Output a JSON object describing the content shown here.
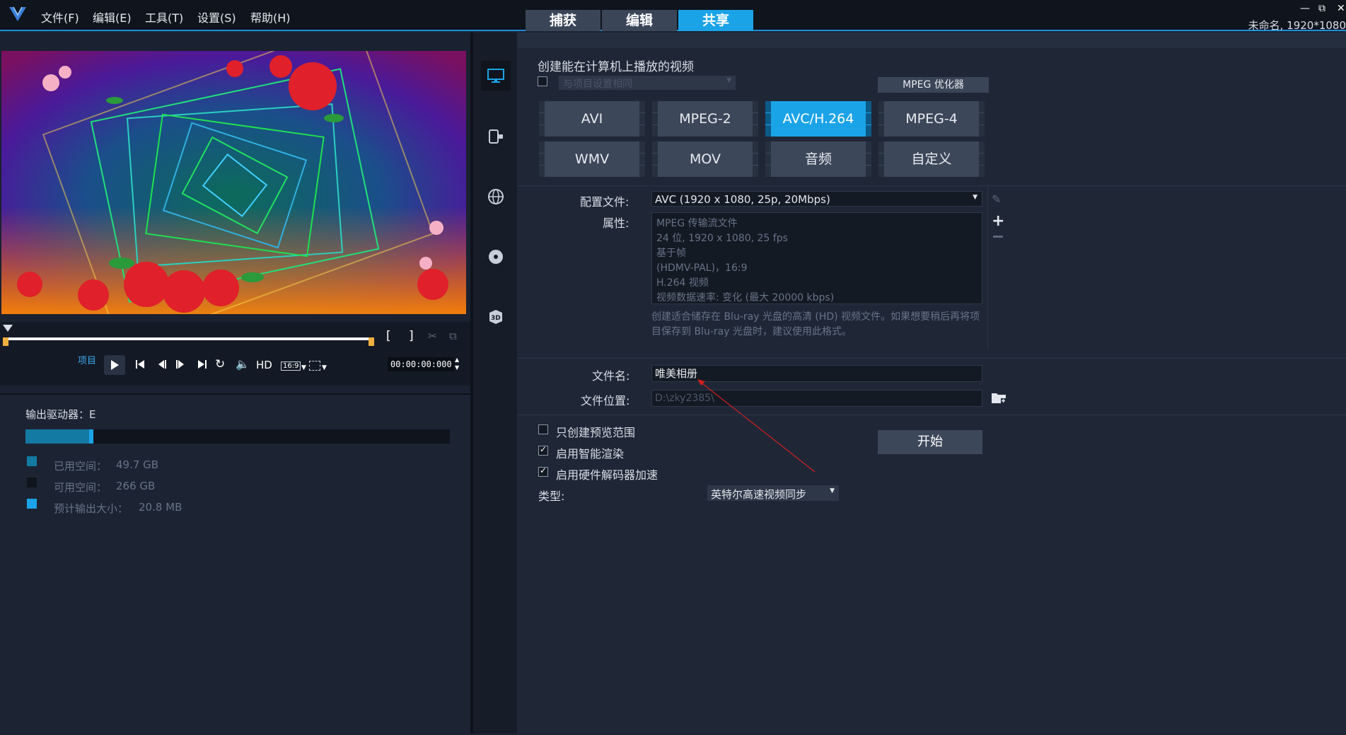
{
  "menu": [
    "文件(F)",
    "编辑(E)",
    "工具(T)",
    "设置(S)",
    "帮助(H)"
  ],
  "mode_tabs": [
    "捕获",
    "编辑",
    "共享"
  ],
  "project_info": "未命名, 1920*1080",
  "player": {
    "project_label": "项目",
    "hd_label": "HD",
    "aspect_label": "16:9",
    "timecode": "00:00:00:000"
  },
  "drive": {
    "output_drive": "输出驱动器：E",
    "used_label": "已用空间：",
    "used_value": "49.7 GB",
    "free_label": "可用空间：",
    "free_value": "266 GB",
    "estimate_label": "预计输出大小：",
    "estimate_value": "20.8 MB",
    "used_fraction": 0.16,
    "colors": {
      "used": "#137aa3",
      "free": "#0f141d",
      "estimate": "#1ba3e8"
    }
  },
  "share": {
    "heading": "创建能在计算机上播放的视频",
    "same_as_project": "与项目设置相同",
    "mpeg_optimizer": "MPEG 优化器",
    "formats": [
      "AVI",
      "MPEG-2",
      "AVC/H.264",
      "MPEG-4",
      "WMV",
      "MOV",
      "音频",
      "自定义"
    ],
    "active_format": "AVC/H.264",
    "profile_label": "配置文件:",
    "profile_value": "AVC (1920 x 1080, 25p, 20Mbps)",
    "properties_label": "属性:",
    "properties": [
      "MPEG 传输流文件",
      "24 位, 1920 x 1080, 25 fps",
      "基于帧",
      "(HDMV-PAL)，16:9",
      "H.264 视频",
      "视频数据速率: 变化 (最大 20000 kbps)"
    ],
    "description": "创建适合储存在 Blu-ray 光盘的高清 (HD) 视频文件。如果想要稍后再将项目保存到 Blu-ray 光盘时，建议使用此格式。",
    "filename_label": "文件名:",
    "filename_value": "唯美相册",
    "location_label": "文件位置:",
    "location_value": "D:\\zky2385\\",
    "preview_only": "只创建预览范围",
    "smart_render": "启用智能渲染",
    "hw_decoder": "启用硬件解码器加速",
    "type_label": "类型:",
    "type_value": "英特尔高速视频同步",
    "start_button": "开始"
  },
  "accent": "#1ba3e8"
}
